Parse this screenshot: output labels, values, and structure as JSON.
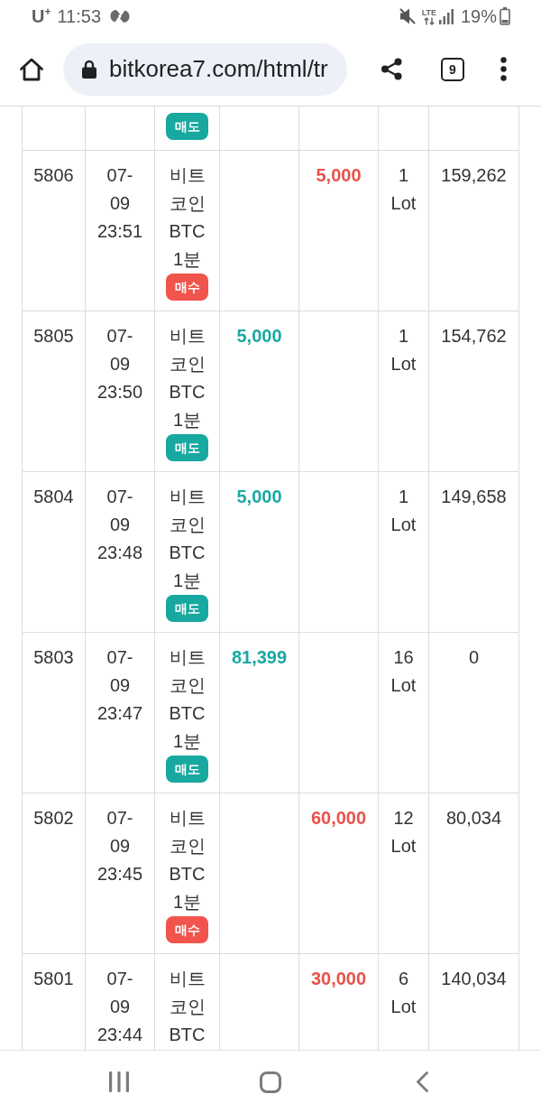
{
  "status_bar": {
    "carrier": "U$^{+}$",
    "time": "11:53",
    "network": "LTE",
    "battery": "19%"
  },
  "browser_toolbar": {
    "url": "bitkorea7.com/html/tr",
    "tab_count": "9"
  },
  "table": {
    "rows": [
      {
        "badge": {
          "kind": "sell",
          "label": "매도"
        }
      },
      {
        "no": "5806",
        "date": "07-09",
        "time": "23:51",
        "product": "비트코인 BTC 1분",
        "badge": {
          "kind": "buy",
          "label": "매수"
        },
        "column_5": "5,000",
        "lots": "1 Lot",
        "column_7": "159,262"
      },
      {
        "no": "5805",
        "date": "07-09",
        "time": "23:50",
        "product": "비트코인 BTC 1분",
        "badge": {
          "kind": "sell",
          "label": "매도"
        },
        "column_4": "5,000",
        "lots": "1 Lot",
        "column_7": "154,762"
      },
      {
        "no": "5804",
        "date": "07-09",
        "time": "23:48",
        "product": "비트코인 BTC 1분",
        "badge": {
          "kind": "sell",
          "label": "매도"
        },
        "column_4": "5,000",
        "lots": "1 Lot",
        "column_7": "149,658"
      },
      {
        "no": "5803",
        "date": "07-09",
        "time": "23:47",
        "product": "비트코인 BTC 1분",
        "badge": {
          "kind": "sell",
          "label": "매도"
        },
        "column_4": "81,399",
        "lots": "16 Lot",
        "column_7": "0"
      },
      {
        "no": "5802",
        "date": "07-09",
        "time": "23:45",
        "product": "비트코인 BTC 1분",
        "badge": {
          "kind": "buy",
          "label": "매수"
        },
        "column_5": "60,000",
        "lots": "12 Lot",
        "column_7": "80,034"
      },
      {
        "no": "5801",
        "date": "07-09",
        "time": "23:44",
        "product": "비트코인 BTC",
        "column_5": "30,000",
        "lots": "6 Lot",
        "column_7": "140,034"
      }
    ]
  }
}
